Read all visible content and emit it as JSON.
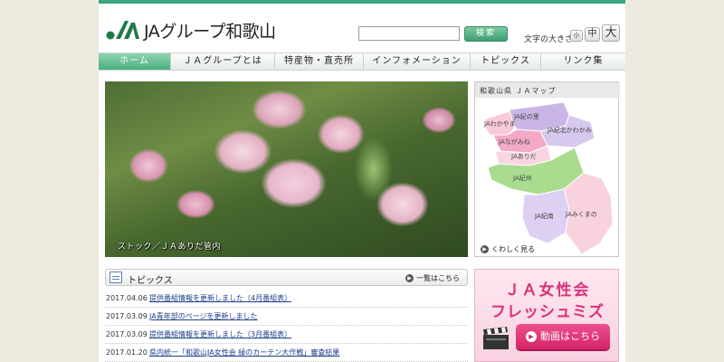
{
  "header": {
    "logo_text": "JAグループ和歌山",
    "search_button": "検索",
    "search_placeholder": "",
    "font_size_label": "文字の大きさ",
    "font_small": "小",
    "font_mid": "中",
    "font_large": "大"
  },
  "nav": {
    "items": [
      "ホーム",
      "ＪＡグループとは",
      "特産物・直売所",
      "インフォメーション",
      "トピックス",
      "リンク集"
    ]
  },
  "hero": {
    "caption": "ストック／ＪＡありだ管内"
  },
  "map": {
    "title": "和歌山県 ＪＡマップ",
    "regions": [
      "JA紀の里",
      "JAわかやま",
      "JA紀北かわかみ",
      "JAながみね",
      "JAありだ",
      "JA紀州",
      "JA紀南",
      "JAみくまの"
    ],
    "more_link": "くわしく見る",
    "colors": {
      "kinosato": "#c9b6e6",
      "wakayama": "#f8c9d9",
      "kihoku": "#d7c8ee",
      "nagamine": "#f3a9c6",
      "arida": "#f8d5e1",
      "kishu": "#a9dc8e",
      "kinan": "#ddd0f2",
      "mikumano": "#f8d2dd"
    }
  },
  "topics": {
    "title": "トピックス",
    "all_link": "一覧はこちら",
    "items": [
      {
        "date": "2017.04.06",
        "title": "提供番組情報を更新しました（4月番組表）"
      },
      {
        "date": "2017.03.09",
        "title": "JA青年部のページを更新しました"
      },
      {
        "date": "2017.03.09",
        "title": "提供番組情報を更新しました（3月番組表）"
      },
      {
        "date": "2017.01.20",
        "title": "県内統一「和歌山JA女性会 緑のカーテン大作戦」審査結果"
      }
    ]
  },
  "banner": {
    "line1": "ＪＡ女性会",
    "line2": "フレッシュミズ",
    "button": "動画はこちら"
  }
}
